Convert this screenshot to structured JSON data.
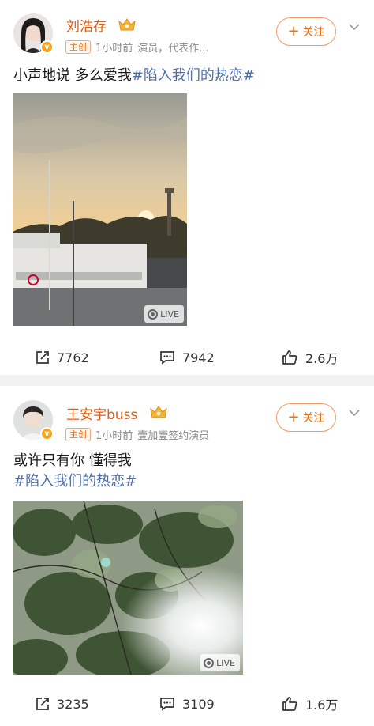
{
  "posts": [
    {
      "user": {
        "name": "刘浩存",
        "role_tag": "主创",
        "time": "1小时前",
        "bio": "演员，代表作..."
      },
      "follow_label": "关注",
      "text": "小声地说 多么爱我",
      "hashtag": "#陷入我们的热恋#",
      "media": {
        "live_label": "LIVE"
      },
      "stats": {
        "reposts": "7762",
        "comments": "7942",
        "likes": "2.6万"
      }
    },
    {
      "user": {
        "name": "王安宇buss",
        "role_tag": "主创",
        "time": "1小时前",
        "bio": "壹加壹签约演员"
      },
      "follow_label": "关注",
      "text": "或许只有你 懂得我",
      "hashtag": "#陷入我们的热恋#",
      "media": {
        "live_label": "LIVE"
      },
      "stats": {
        "reposts": "3235",
        "comments": "3109",
        "likes": "1.6万"
      }
    }
  ],
  "colors": {
    "brand_orange": "#e8590c",
    "hashtag_blue": "#4e6fa8",
    "badge_gold": "#f7a21b"
  },
  "icons": [
    "crown-icon",
    "verified-icon",
    "chevron-down-icon",
    "repost-icon",
    "comment-icon",
    "like-icon",
    "live-photo-icon"
  ]
}
